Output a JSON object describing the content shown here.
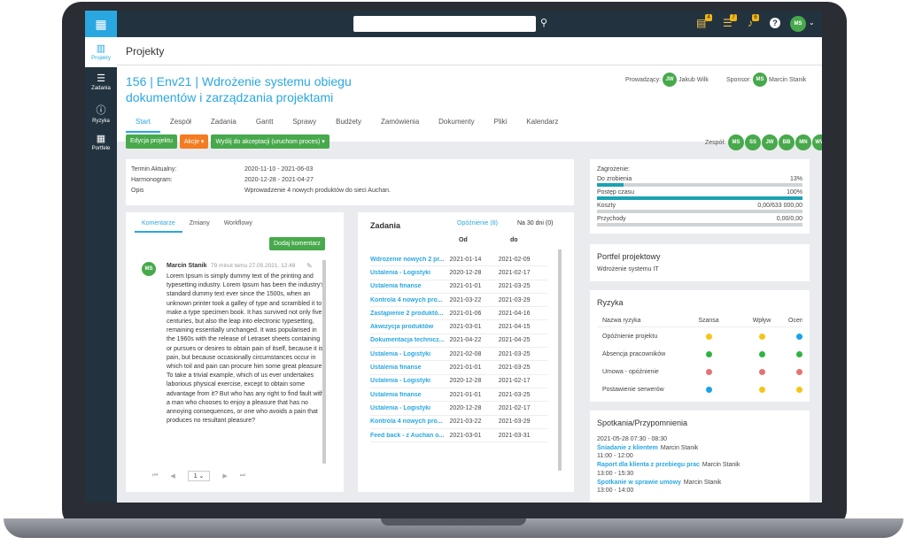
{
  "topbar": {
    "badges": [
      "4",
      "7",
      "6"
    ],
    "user": "MS"
  },
  "sidebar": [
    {
      "label": "Projekty",
      "icon": "▥"
    },
    {
      "label": "Zadania",
      "icon": "☰"
    },
    {
      "label": "Ryzyka",
      "icon": "ⓘ"
    },
    {
      "label": "Portfele",
      "icon": "▦"
    }
  ],
  "header": {
    "title": "Projekty"
  },
  "project": {
    "title": "156 | Env21 | Wdrożenie systemu obiegu dokumentów i zarządzania projektami",
    "lead_label": "Prowadzący:",
    "lead_initials": "JW",
    "lead_name": "Jakub Wilk",
    "sponsor_label": "Sponsor:",
    "sponsor_initials": "MS",
    "sponsor_name": "Marcin Stanik"
  },
  "tabs": [
    "Start",
    "Zespół",
    "Zadania",
    "Gantt",
    "Sprawy",
    "Budżety",
    "Zamówienia",
    "Dokumenty",
    "Pliki",
    "Kalendarz"
  ],
  "buttons": {
    "edit": "Edycja projektu",
    "actions": "Akcje ▾",
    "send": "Wyślij do akceptacji (uruchom proces) ▾"
  },
  "team": {
    "label": "Zespół:",
    "members": [
      "MS",
      "SS",
      "JW",
      "BB",
      "MN",
      "WW"
    ]
  },
  "info": {
    "l1": "Termin Aktualny:",
    "v1": "2020-11-10 - 2021-06-03",
    "l2": "Harmonogram:",
    "v2": "2020-12-28 - 2021-04-27",
    "l3": "Opis",
    "v3": "Wprowadzenie 4 nowych produktów do sieci Auchan."
  },
  "comments": {
    "tabs": [
      "Komentarze",
      "Zmiany",
      "Workflowy"
    ],
    "add": "Dodaj komentarz",
    "author": "Marcin Stanik",
    "initials": "MS",
    "time": "79 minut temu 27.05.2021, 12:48",
    "text": "Lorem Ipsum is simply dummy text of the printing and typesetting industry. Lorem Ipsum has been the industry's standard dummy text ever since the 1500s, when an unknown printer took a galley of type and scrambled it to make a type specimen book. It has survived not only five centuries, but also the leap into electronic typesetting, remaining essentially unchanged. It was popularised in the 1960s with the release of Letraset sheets containing or pursues or desires to obtain pain of itself, because it is pain, but because occasionally circumstances occur in which toil and pain can procure him some great pleasure. To take a trivial example, which of us ever undertakes laborious physical exercise, except to obtain some advantage from it? But who has any right to find fault with a man who chooses to enjoy a pleasure that has no annoying consequences, or one who avoids a pain that produces no resultant pleasure?",
    "page": "1"
  },
  "tasks": {
    "title": "Zadania",
    "late": "Opóźnienie (8)",
    "next30": "Na 30 dni (0)",
    "col_from": "Od",
    "col_to": "do",
    "rows": [
      [
        "Wdrożenie nowych 2 pr...",
        "2021-01-14",
        "2021-02-09"
      ],
      [
        "Ustalenia - Logistyki",
        "2020-12-28",
        "2021-02-17"
      ],
      [
        "Ustalenia finanse",
        "2021-01-01",
        "2021-03-25"
      ],
      [
        "Kontrola 4 nowych pro...",
        "2021-03-22",
        "2021-03-29"
      ],
      [
        "Zastąpienie 2 produktó...",
        "2021-01-06",
        "2021-04-16"
      ],
      [
        "Akwizycja produktów",
        "2021-03-01",
        "2021-04-15"
      ],
      [
        "Dokumentacja technicz...",
        "2021-04-22",
        "2021-04-25"
      ],
      [
        "Ustalenia - Logistyki",
        "2021-02-08",
        "2021-03-25"
      ],
      [
        "Ustalenia finanse",
        "2021-01-01",
        "2021-03-25"
      ],
      [
        "Ustalenia - Logistyki",
        "2020-12-28",
        "2021-02-17"
      ],
      [
        "Ustalenia finanse",
        "2021-01-01",
        "2021-03-25"
      ],
      [
        "Ustalenia - Logistyki",
        "2020-12-28",
        "2021-02-17"
      ],
      [
        "Kontrola 4 nowych pro...",
        "2021-03-22",
        "2021-03-29"
      ],
      [
        "Feed back - z Auchan o...",
        "2021-03-01",
        "2021-03-31"
      ]
    ]
  },
  "metrics": {
    "threat": "Zagrożenie:",
    "todo": "Do zrobienia",
    "todo_v": "13%",
    "todo_fill": 0.13,
    "time": "Postęp czasu",
    "time_v": "100%",
    "time_fill": 1.0,
    "costs": "Koszty",
    "costs_v": "0,00/633 000,00",
    "costs_fill": 0,
    "income": "Przychody",
    "income_v": "0,00/0,00",
    "income_fill": 0
  },
  "portfolio": {
    "title": "Portfel projektowy",
    "value": "Wdrożenie systemu IT"
  },
  "risks": {
    "title": "Ryzyka",
    "cols": [
      "Nazwa ryzyka",
      "Szansa",
      "Wpływ",
      "Ocena"
    ],
    "rows": [
      {
        "name": "Opóźnienie projektu",
        "c": [
          "#f5c518",
          "#f5c518",
          "#1aa3e8"
        ]
      },
      {
        "name": "Absencja pracowników",
        "c": [
          "#2fb344",
          "#2fb344",
          "#2fb344"
        ]
      },
      {
        "name": "Umowa - opóźnienie",
        "c": [
          "#e57373",
          "#e57373",
          "#e57373"
        ]
      },
      {
        "name": "Postawienie serwerów",
        "c": [
          "#1aa3e8",
          "#f5c518",
          "#f5c518"
        ]
      }
    ]
  },
  "meetings": {
    "title": "Spotkania/Przypomnienia",
    "items": [
      {
        "time": "2021-05-28 07:30 - 08:30",
        "title": "Śniadanie z klientem",
        "who": "Marcin Stanik"
      },
      {
        "time": "11:00 - 12:00",
        "title": "Raport dla klienta z przebiegu prac",
        "who": "Marcin Stanik"
      },
      {
        "time": "13:00 - 15:30",
        "title": "Spotkanie w sprawie umowy",
        "who": "Marcin Stanik"
      },
      {
        "time": "13:00 - 14:00",
        "title": "",
        "who": ""
      }
    ]
  }
}
